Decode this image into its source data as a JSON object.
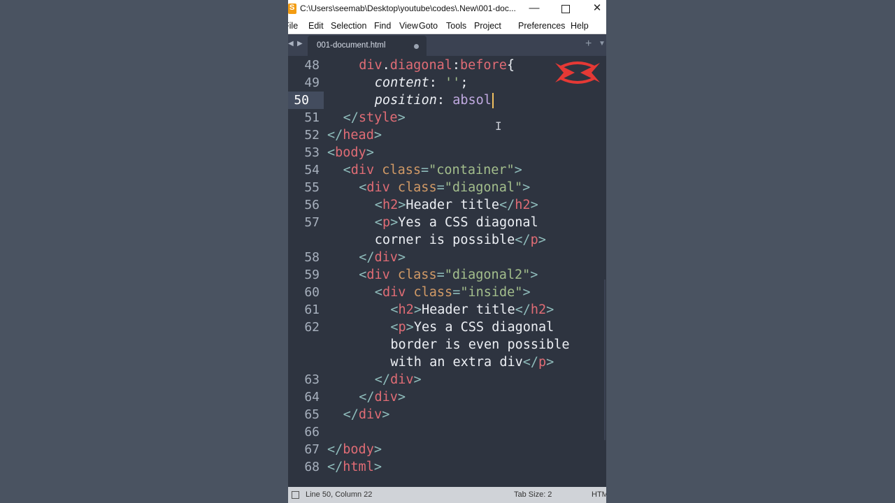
{
  "window": {
    "title": "C:\\Users\\seemab\\Desktop\\youtube\\codes\\.New\\001-doc...",
    "minimize_glyph": "—",
    "close_glyph": "✕"
  },
  "menu": [
    "File",
    "Edit",
    "Selection",
    "Find",
    "View",
    "Goto",
    "Tools",
    "Project",
    "Preferences",
    "Help"
  ],
  "tab": {
    "label": "001-document.html",
    "new_tab_glyph": "+",
    "dropdown_glyph": "▼",
    "prev_glyph": "◀",
    "next_glyph": "▶"
  },
  "editor": {
    "cursor_icon": "text-cursor-icon",
    "lines": [
      {
        "n": "48",
        "tokens": [
          [
            "sl",
            "div"
          ],
          [
            "tx",
            "."
          ],
          [
            "sl",
            "diagonal"
          ],
          [
            "tx",
            ":"
          ],
          [
            "sl",
            "before"
          ],
          [
            "tx",
            "{"
          ]
        ],
        "indent": 2
      },
      {
        "n": "49",
        "tokens": [
          [
            "pr",
            "content"
          ],
          [
            "tx",
            ": "
          ],
          [
            "st",
            "''"
          ],
          [
            "tx",
            ";"
          ]
        ],
        "indent": 3
      },
      {
        "n": "50",
        "tokens": [
          [
            "pr",
            "position"
          ],
          [
            "tx",
            ": "
          ],
          [
            "vl",
            "absol"
          ]
        ],
        "indent": 3,
        "current": true
      },
      {
        "n": "51",
        "tokens": [
          [
            "pn",
            "</"
          ],
          [
            "tg",
            "style"
          ],
          [
            "pn",
            ">"
          ]
        ],
        "indent": 1
      },
      {
        "n": "52",
        "tokens": [
          [
            "pn",
            "</"
          ],
          [
            "tg",
            "head"
          ],
          [
            "pn",
            ">"
          ]
        ],
        "indent": 0
      },
      {
        "n": "53",
        "tokens": [
          [
            "pn",
            "<"
          ],
          [
            "tg",
            "body"
          ],
          [
            "pn",
            ">"
          ]
        ],
        "indent": 0
      },
      {
        "n": "54",
        "tokens": [
          [
            "pn",
            "<"
          ],
          [
            "tg",
            "div "
          ],
          [
            "at",
            "class"
          ],
          [
            "pn",
            "="
          ],
          [
            "st",
            "\"container\""
          ],
          [
            "pn",
            ">"
          ]
        ],
        "indent": 1
      },
      {
        "n": "55",
        "tokens": [
          [
            "pn",
            "<"
          ],
          [
            "tg",
            "div "
          ],
          [
            "at",
            "class"
          ],
          [
            "pn",
            "="
          ],
          [
            "st",
            "\"diagonal\""
          ],
          [
            "pn",
            ">"
          ]
        ],
        "indent": 2
      },
      {
        "n": "56",
        "tokens": [
          [
            "pn",
            "<"
          ],
          [
            "tg",
            "h2"
          ],
          [
            "pn",
            ">"
          ],
          [
            "tx",
            "Header title"
          ],
          [
            "pn",
            "</"
          ],
          [
            "tg",
            "h2"
          ],
          [
            "pn",
            ">"
          ]
        ],
        "indent": 3
      },
      {
        "n": "57",
        "tokens": [
          [
            "pn",
            "<"
          ],
          [
            "tg",
            "p"
          ],
          [
            "pn",
            ">"
          ],
          [
            "tx",
            "Yes a CSS diagonal"
          ]
        ],
        "indent": 3
      },
      {
        "n": "",
        "tokens": [
          [
            "tx",
            "corner is possible"
          ],
          [
            "pn",
            "</"
          ],
          [
            "tg",
            "p"
          ],
          [
            "pn",
            ">"
          ]
        ],
        "indent": 3
      },
      {
        "n": "58",
        "tokens": [
          [
            "pn",
            "</"
          ],
          [
            "tg",
            "div"
          ],
          [
            "pn",
            ">"
          ]
        ],
        "indent": 2
      },
      {
        "n": "59",
        "tokens": [
          [
            "pn",
            "<"
          ],
          [
            "tg",
            "div "
          ],
          [
            "at",
            "class"
          ],
          [
            "pn",
            "="
          ],
          [
            "st",
            "\"diagonal2\""
          ],
          [
            "pn",
            ">"
          ]
        ],
        "indent": 2
      },
      {
        "n": "60",
        "tokens": [
          [
            "pn",
            "<"
          ],
          [
            "tg",
            "div "
          ],
          [
            "at",
            "class"
          ],
          [
            "pn",
            "="
          ],
          [
            "st",
            "\"inside\""
          ],
          [
            "pn",
            ">"
          ]
        ],
        "indent": 3
      },
      {
        "n": "61",
        "tokens": [
          [
            "pn",
            "<"
          ],
          [
            "tg",
            "h2"
          ],
          [
            "pn",
            ">"
          ],
          [
            "tx",
            "Header title"
          ],
          [
            "pn",
            "</"
          ],
          [
            "tg",
            "h2"
          ],
          [
            "pn",
            ">"
          ]
        ],
        "indent": 4
      },
      {
        "n": "62",
        "tokens": [
          [
            "pn",
            "<"
          ],
          [
            "tg",
            "p"
          ],
          [
            "pn",
            ">"
          ],
          [
            "tx",
            "Yes a CSS diagonal"
          ]
        ],
        "indent": 4
      },
      {
        "n": "",
        "tokens": [
          [
            "tx",
            "border is even possible"
          ]
        ],
        "indent": 4
      },
      {
        "n": "",
        "tokens": [
          [
            "tx",
            "with an extra div"
          ],
          [
            "pn",
            "</"
          ],
          [
            "tg",
            "p"
          ],
          [
            "pn",
            ">"
          ]
        ],
        "indent": 4
      },
      {
        "n": "63",
        "tokens": [
          [
            "pn",
            "</"
          ],
          [
            "tg",
            "div"
          ],
          [
            "pn",
            ">"
          ]
        ],
        "indent": 3
      },
      {
        "n": "64",
        "tokens": [
          [
            "pn",
            "</"
          ],
          [
            "tg",
            "div"
          ],
          [
            "pn",
            ">"
          ]
        ],
        "indent": 2
      },
      {
        "n": "65",
        "tokens": [
          [
            "pn",
            "</"
          ],
          [
            "tg",
            "div"
          ],
          [
            "pn",
            ">"
          ]
        ],
        "indent": 1
      },
      {
        "n": "66",
        "tokens": [],
        "indent": 0
      },
      {
        "n": "67",
        "tokens": [
          [
            "pn",
            "</"
          ],
          [
            "tg",
            "body"
          ],
          [
            "pn",
            ">"
          ]
        ],
        "indent": 0
      },
      {
        "n": "68",
        "tokens": [
          [
            "pn",
            "</"
          ],
          [
            "tg",
            "html"
          ],
          [
            "pn",
            ">"
          ]
        ],
        "indent": 0
      }
    ]
  },
  "status": {
    "position": "Line 50, Column 22",
    "tab_size": "Tab Size: 2",
    "syntax": "HTM"
  },
  "colors": {
    "background": "#4a5361",
    "editor": "#2e3440",
    "logo": "#e53935"
  }
}
